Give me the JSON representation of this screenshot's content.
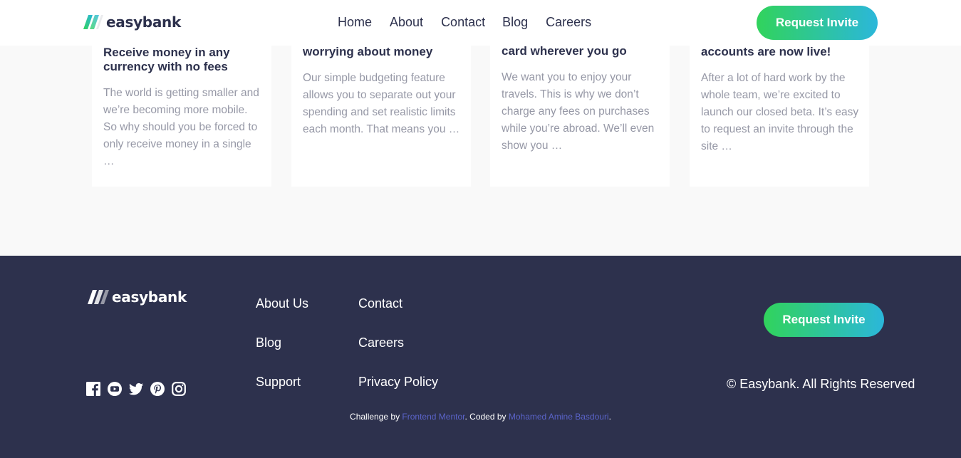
{
  "brand": {
    "name": "easybank"
  },
  "nav": {
    "items": [
      "Home",
      "About",
      "Contact",
      "Blog",
      "Careers"
    ],
    "cta_label": "Request Invite"
  },
  "articles": [
    {
      "title": "Receive money in any currency with no fees",
      "excerpt": "The world is getting smaller and we’re becoming more mobile. So why should you be forced to only receive money in a single …"
    },
    {
      "title": "worrying about money",
      "excerpt": "Our simple budgeting feature allows you to separate out your spending and set realistic limits each month. That means you …"
    },
    {
      "title": "card wherever you go",
      "excerpt": "We want you to enjoy your travels. This is why we don’t charge any fees on purchases while you’re abroad. We’ll even show you …"
    },
    {
      "title": "accounts are now live!",
      "excerpt": "After a lot of hard work by the whole team, we’re excited to launch our closed beta. It’s easy to request an invite through the site …"
    }
  ],
  "footer": {
    "social_icons": [
      "facebook-icon",
      "youtube-icon",
      "twitter-icon",
      "pinterest-icon",
      "instagram-icon"
    ],
    "links_col1": [
      "About Us",
      "Blog",
      "Support"
    ],
    "links_col2": [
      "Contact",
      "Careers",
      "Privacy Policy"
    ],
    "cta_label": "Request Invite",
    "copyright": "© Easybank. All Rights Reserved"
  },
  "attribution": {
    "prefix": "Challenge by ",
    "challenge_link": "Frontend Mentor",
    "middle": ". Coded by ",
    "author_link": "Mohamed Amine Basdouri",
    "suffix": "."
  },
  "colors": {
    "dark_blue": "#2d314d",
    "lime_green": "#31d35c",
    "bright_cyan": "#2bb7da",
    "grayish_blue": "#9698a6",
    "light_gray_bg": "#f9f9f9",
    "link_blue": "#5a63c8"
  }
}
